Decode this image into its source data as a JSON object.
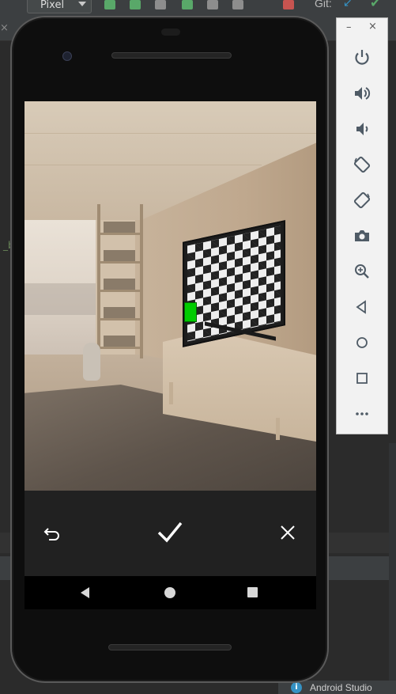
{
  "ide": {
    "device_selector": "Pixel",
    "vcs_label": "Git:",
    "status_notification": "Android Studio"
  },
  "emulator_toolbar": {
    "minimize": "–",
    "close": "×",
    "buttons": [
      {
        "icon": "power-icon"
      },
      {
        "icon": "volume-up-icon"
      },
      {
        "icon": "volume-down-icon"
      },
      {
        "icon": "rotate-left-icon"
      },
      {
        "icon": "rotate-right-icon"
      },
      {
        "icon": "camera-icon"
      },
      {
        "icon": "zoom-icon"
      },
      {
        "icon": "back-icon"
      },
      {
        "icon": "home-icon"
      },
      {
        "icon": "overview-icon"
      },
      {
        "icon": "more-icon"
      }
    ]
  },
  "camera_review": {
    "actions": [
      {
        "icon": "retake-icon"
      },
      {
        "icon": "accept-check-icon"
      },
      {
        "icon": "cancel-icon"
      }
    ]
  },
  "colors": {
    "ide_background": "#2b2b2b",
    "marker_green": "#00cc00",
    "controls_bar": "#212121",
    "emulator_panel": "#f2f2f2"
  }
}
